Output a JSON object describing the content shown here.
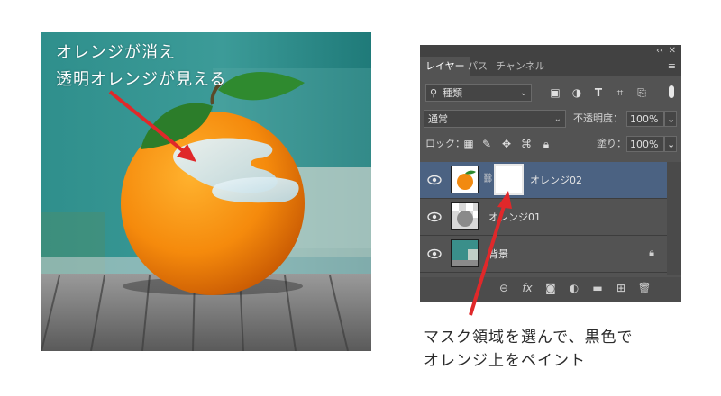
{
  "annotation": {
    "line1": "オレンジが消え",
    "line2": "透明オレンジが見える"
  },
  "caption": {
    "line1": "マスク領域を選んで、黒色で",
    "line2": "オレンジ上をペイント"
  },
  "panel": {
    "collapse": "‹‹",
    "close": "✕",
    "tabs": [
      {
        "label": "レイヤー",
        "active": true
      },
      {
        "label": "パス",
        "active": false
      },
      {
        "label": "チャンネル",
        "active": false
      }
    ],
    "menu_icon": "≡",
    "filter": {
      "icon": "search-icon",
      "value": "種類"
    },
    "blend_mode": "通常",
    "opacity_label": "不透明度：",
    "opacity_value": "100%",
    "lock_label": "ロック：",
    "fill_label": "塗り：",
    "fill_value": "100%",
    "layers": [
      {
        "name": "オレンジ02",
        "selected": true,
        "has_mask": true
      },
      {
        "name": "オレンジ01",
        "selected": false,
        "has_mask": false
      },
      {
        "name": "背景",
        "selected": false,
        "has_mask": false,
        "locked": true
      }
    ],
    "bottom_icons": [
      "link-icon",
      "fx-icon",
      "mask-icon",
      "adjustment-icon",
      "folder-icon",
      "new-layer-icon",
      "trash-icon"
    ],
    "fx_label": "fx"
  },
  "colors": {
    "panel_bg": "#535353",
    "selected_layer": "#4b6282",
    "arrow": "#e0282a"
  }
}
